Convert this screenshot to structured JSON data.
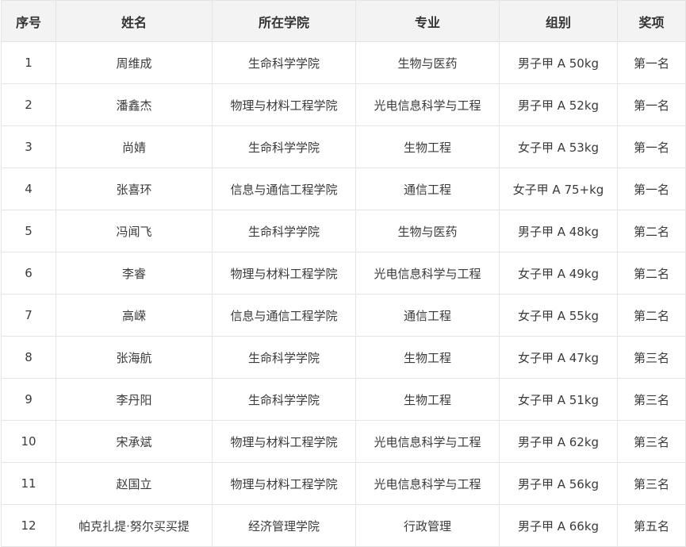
{
  "table": {
    "headers": [
      "序号",
      "姓名",
      "所在学院",
      "专业",
      "组别",
      "奖项"
    ],
    "rows": [
      [
        "1",
        "周维成",
        "生命科学学院",
        "生物与医药",
        "男子甲 A 50kg",
        "第一名"
      ],
      [
        "2",
        "潘鑫杰",
        "物理与材料工程学院",
        "光电信息科学与工程",
        "男子甲 A 52kg",
        "第一名"
      ],
      [
        "3",
        "尚婧",
        "生命科学学院",
        "生物工程",
        "女子甲 A 53kg",
        "第一名"
      ],
      [
        "4",
        "张喜环",
        "信息与通信工程学院",
        "通信工程",
        "女子甲 A 75+kg",
        "第一名"
      ],
      [
        "5",
        "冯闻飞",
        "生命科学学院",
        "生物与医药",
        "男子甲 A 48kg",
        "第二名"
      ],
      [
        "6",
        "李睿",
        "物理与材料工程学院",
        "光电信息科学与工程",
        "女子甲 A 49kg",
        "第二名"
      ],
      [
        "7",
        "高嵘",
        "信息与通信工程学院",
        "通信工程",
        "女子甲 A 55kg",
        "第二名"
      ],
      [
        "8",
        "张海航",
        "生命科学学院",
        "生物工程",
        "女子甲 A 47kg",
        "第三名"
      ],
      [
        "9",
        "李丹阳",
        "生命科学学院",
        "生物工程",
        "女子甲 A 51kg",
        "第三名"
      ],
      [
        "10",
        "宋承斌",
        "物理与材料工程学院",
        "光电信息科学与工程",
        "男子甲 A 62kg",
        "第三名"
      ],
      [
        "11",
        "赵国立",
        "物理与材料工程学院",
        "光电信息科学与工程",
        "男子甲 A 56kg",
        "第三名"
      ],
      [
        "12",
        "帕克扎提·努尔买买提",
        "经济管理学院",
        "行政管理",
        "男子甲 A 66kg",
        "第五名"
      ]
    ]
  }
}
